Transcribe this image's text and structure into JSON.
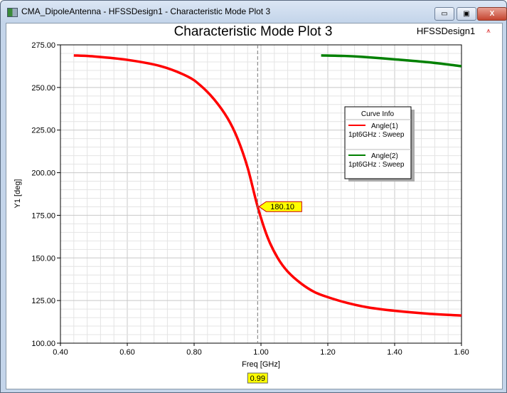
{
  "window": {
    "title": "CMA_DipoleAntenna - HFSSDesign1 - Characteristic Mode Plot 3",
    "minimize": "▭",
    "maximize": "▣",
    "close": "X"
  },
  "chart_data": {
    "type": "line",
    "title": "Characteristic Mode Plot 3",
    "design_label": "HFSSDesign1",
    "xlabel": "Freq [GHz]",
    "ylabel": "Y1 [deg]",
    "xlim": [
      0.4,
      1.6
    ],
    "ylim": [
      100,
      275
    ],
    "xticks": [
      "0.40",
      "0.60",
      "0.80",
      "1.00",
      "1.20",
      "1.40",
      "1.60"
    ],
    "yticks": [
      "100.00",
      "125.00",
      "150.00",
      "175.00",
      "200.00",
      "225.00",
      "250.00",
      "275.00"
    ],
    "grid": true,
    "legend": {
      "title": "Curve Info",
      "placement": "right"
    },
    "series": [
      {
        "name": "Angle(1)",
        "sub": "1pt6GHz : Sweep",
        "color": "#ff0000",
        "x": [
          0.44,
          0.5,
          0.6,
          0.7,
          0.78,
          0.82,
          0.86,
          0.9,
          0.93,
          0.96,
          0.99,
          1.02,
          1.05,
          1.08,
          1.12,
          1.16,
          1.2,
          1.26,
          1.32,
          1.4,
          1.5,
          1.6
        ],
        "y": [
          268.8,
          268.2,
          266.2,
          262.5,
          256.5,
          251,
          243,
          232,
          220,
          203,
          180.1,
          162,
          150,
          142,
          135,
          130,
          127,
          123.5,
          121,
          119,
          117.3,
          116.2
        ]
      },
      {
        "name": "Angle(2)",
        "sub": "1pt6GHz : Sweep",
        "color": "#008000",
        "x": [
          1.18,
          1.25,
          1.3,
          1.4,
          1.5,
          1.6
        ],
        "y": [
          268.8,
          268.5,
          268,
          266.5,
          264.8,
          262.5
        ]
      }
    ],
    "marker": {
      "x": 0.99,
      "x_label": "0.99",
      "y_label": "180.10"
    }
  }
}
